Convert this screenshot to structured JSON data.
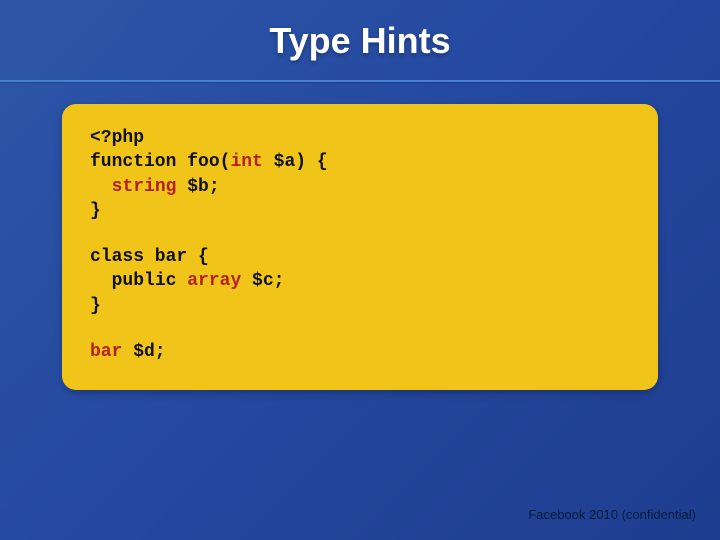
{
  "title": "Type Hints",
  "code": {
    "block1": {
      "l1": "<?php",
      "l2a": "function foo(",
      "l2b": "int",
      "l2c": " $a) {",
      "l3a": "string",
      "l3b": " $b;",
      "l4": "}"
    },
    "block2": {
      "l1": "class bar {",
      "l2a": "public ",
      "l2b": "array",
      "l2c": " $c;",
      "l3": "}"
    },
    "block3": {
      "l1a": "bar",
      "l1b": " $d;"
    }
  },
  "footer": "Facebook 2010 (confidential)"
}
